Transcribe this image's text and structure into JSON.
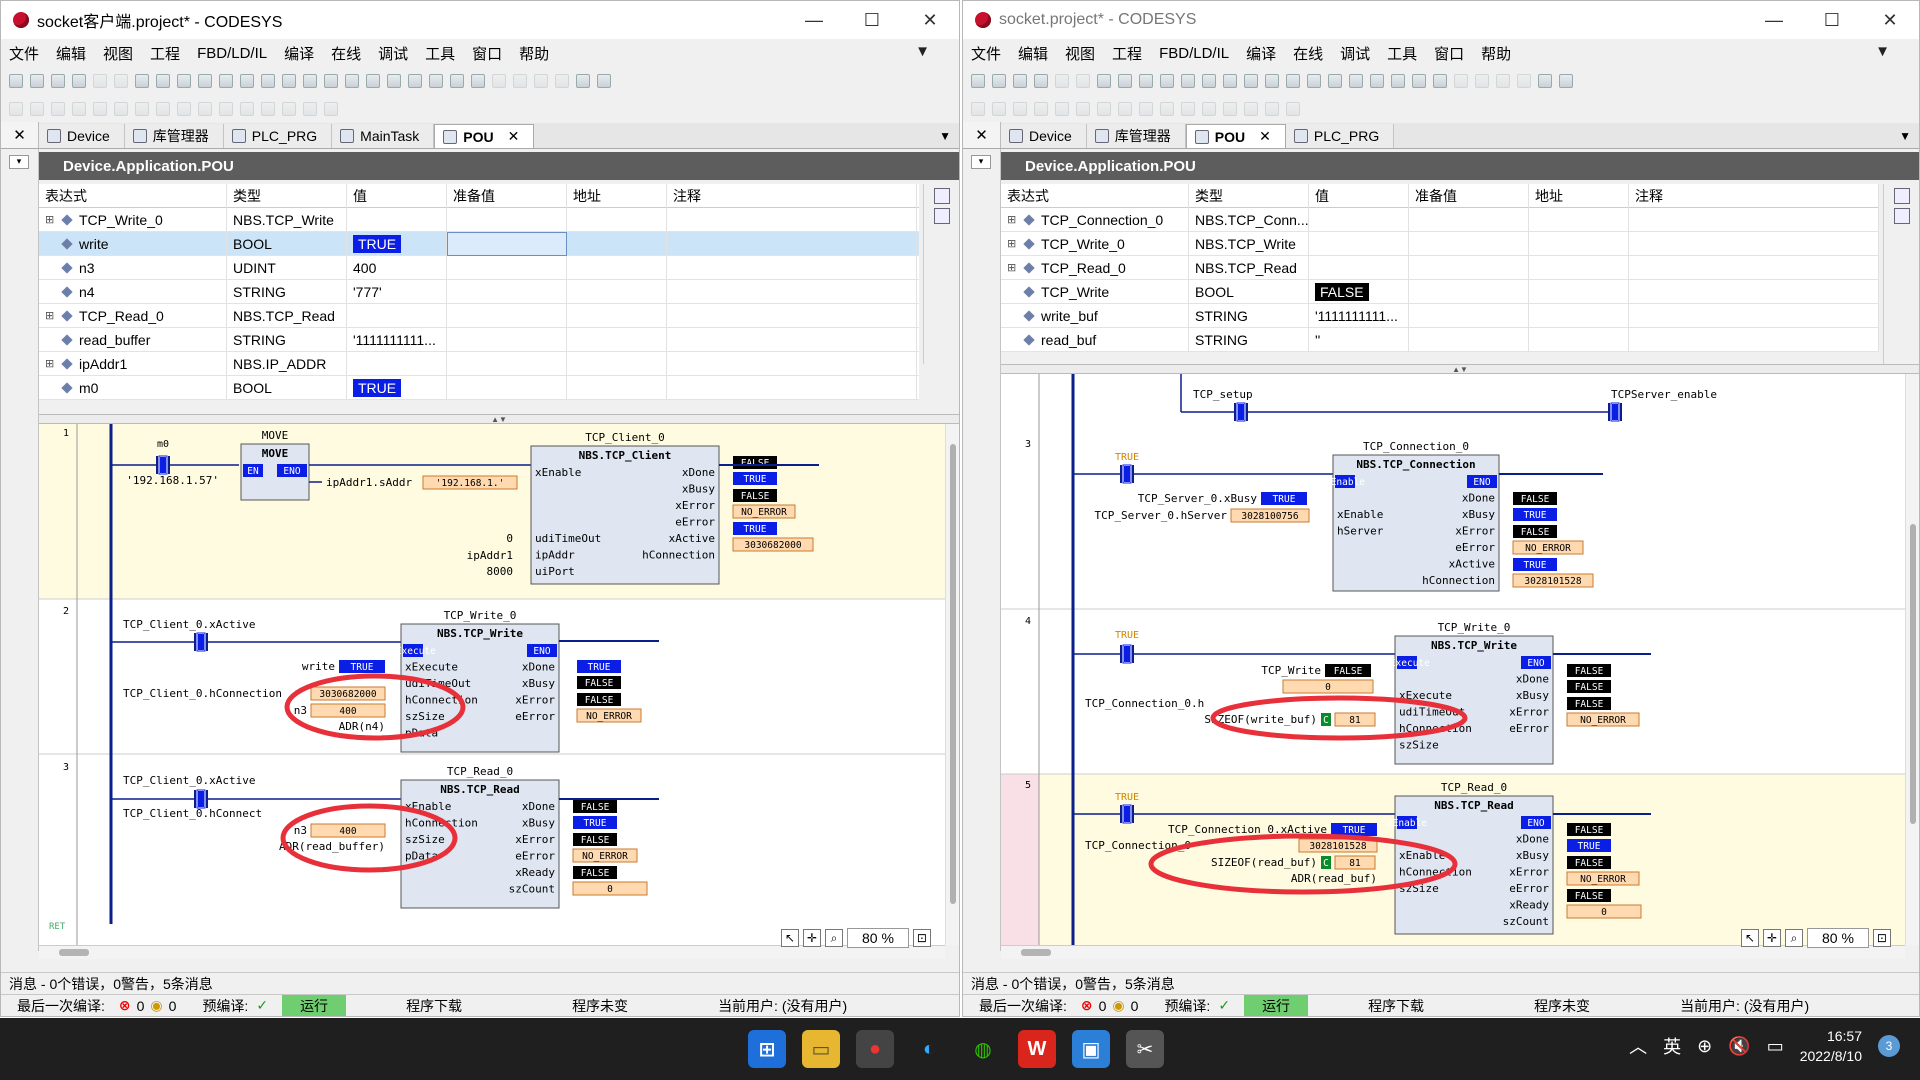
{
  "left": {
    "title": "socket客户端.project* - CODESYS",
    "menu": [
      "文件",
      "编辑",
      "视图",
      "工程",
      "FBD/LD/IL",
      "编译",
      "在线",
      "调试",
      "工具",
      "窗口",
      "帮助"
    ],
    "tabs": [
      "Device",
      "库管理器",
      "PLC_PRG",
      "MainTask",
      "POU"
    ],
    "path": "Device.Application.POU",
    "columns": [
      "表达式",
      "类型",
      "值",
      "准备值",
      "地址",
      "注释"
    ],
    "rows": [
      {
        "exp": "⊞",
        "name": "TCP_Write_0",
        "type": "NBS.TCP_Write",
        "value": ""
      },
      {
        "exp": "",
        "name": "write",
        "type": "BOOL",
        "value": "TRUE"
      },
      {
        "exp": "",
        "name": "n3",
        "type": "UDINT",
        "value": "400"
      },
      {
        "exp": "",
        "name": "n4",
        "type": "STRING",
        "value": "'777'"
      },
      {
        "exp": "⊞",
        "name": "TCP_Read_0",
        "type": "NBS.TCP_Read",
        "value": ""
      },
      {
        "exp": "",
        "name": "read_buffer",
        "type": "STRING",
        "value": "'1111111111..."
      },
      {
        "exp": "⊞",
        "name": "ipAddr1",
        "type": "NBS.IP_ADDR",
        "value": ""
      },
      {
        "exp": "",
        "name": "m0",
        "type": "BOOL",
        "value": "TRUE"
      }
    ],
    "zoom": "80 %",
    "messages": "消息 - 0个错误，0警告，5条消息",
    "status": {
      "last_compile": "最后一次编译:",
      "errors": "0",
      "warnings": "0",
      "precompile": "预编译:",
      "run": "运行",
      "download": "程序下载",
      "unchanged": "程序未变",
      "user": "当前用户: (没有用户)"
    },
    "gutter_label": "设P..",
    "ladder": {
      "r1": {
        "num": "1",
        "m0": "m0",
        "move": "MOVE",
        "en": "EN",
        "eno": "ENO",
        "ip_const": "'192.168.1.57'",
        "saddr": "ipAddr1.sAddr",
        "saddr_val": "'192.168.1.'",
        "inst": "TCP_Client_0",
        "fb": "NBS.TCP_Client",
        "xEnable": "xEnable",
        "xDone": "xDone",
        "xBusy": "xBusy",
        "xError": "xError",
        "eError": "eError",
        "xActive": "xActive",
        "hConnection": "hConnection",
        "udiTimeOut": "udiTimeOut",
        "ipAddr": "ipAddr",
        "uiPort": "uiPort",
        "zero": "0",
        "ipAddr1": "ipAddr1",
        "port": "8000",
        "v_done": "FALSE",
        "v_busy": "TRUE",
        "v_err": "FALSE",
        "v_eerr": "NO_ERROR",
        "v_act": "TRUE",
        "v_h": "3030682000"
      },
      "r2": {
        "num": "2",
        "contact": "TCP_Client_0.xActive",
        "inst": "TCP_Write_0",
        "fb": "NBS.TCP_Write",
        "write": "write",
        "write_val": "TRUE",
        "hconn": "TCP_Client_0.hConnection",
        "hval": "3030682000",
        "n3": "n3",
        "n3val": "400",
        "adr": "ADR(n4)",
        "xExecute": "xExecute",
        "udiTimeOut": "udiTimeOut",
        "hConnection": "hConnection",
        "szSize": "szSize",
        "pData": "pData",
        "xDone": "xDone",
        "xBusy": "xBusy",
        "xError": "xError",
        "eError": "eError",
        "v_done": "TRUE",
        "v_busy": "FALSE",
        "v_err": "FALSE",
        "v_eerr": "NO_ERROR"
      },
      "r3": {
        "num": "3",
        "contact": "TCP_Client_0.xActive",
        "inst": "TCP_Read_0",
        "fb": "NBS.TCP_Read",
        "hconn": "TCP_Client_0.hConnect",
        "n3": "n3",
        "n3val": "400",
        "adr": "ADR(read_buffer)",
        "xEnable": "xEnable",
        "hConnection": "hConnection",
        "szSize": "szSize",
        "pData": "pData",
        "xDone": "xDone",
        "xBusy": "xBusy",
        "xError": "xError",
        "eError": "eError",
        "xReady": "xReady",
        "szCount": "szCount",
        "v_done": "FALSE",
        "v_busy": "TRUE",
        "v_err": "FALSE",
        "v_eerr": "NO_ERROR",
        "v_ready": "FALSE",
        "v_cnt": "0"
      },
      "ret": "RET"
    }
  },
  "right": {
    "title": "socket.project* - CODESYS",
    "menu": [
      "文件",
      "编辑",
      "视图",
      "工程",
      "FBD/LD/IL",
      "编译",
      "在线",
      "调试",
      "工具",
      "窗口",
      "帮助"
    ],
    "tabs": [
      "Device",
      "库管理器",
      "POU",
      "PLC_PRG"
    ],
    "path": "Device.Application.POU",
    "columns": [
      "表达式",
      "类型",
      "值",
      "准备值",
      "地址",
      "注释"
    ],
    "rows": [
      {
        "exp": "⊞",
        "name": "TCP_Connection_0",
        "type": "NBS.TCP_Conn...",
        "value": ""
      },
      {
        "exp": "⊞",
        "name": "TCP_Write_0",
        "type": "NBS.TCP_Write",
        "value": ""
      },
      {
        "exp": "⊞",
        "name": "TCP_Read_0",
        "type": "NBS.TCP_Read",
        "value": ""
      },
      {
        "exp": "",
        "name": "TCP_Write",
        "type": "BOOL",
        "value": "FALSE"
      },
      {
        "exp": "",
        "name": "write_buf",
        "type": "STRING",
        "value": "'1111111111..."
      },
      {
        "exp": "",
        "name": "read_buf",
        "type": "STRING",
        "value": "''"
      }
    ],
    "zoom": "80 %",
    "messages": "消息 - 0个错误，0警告，5条消息",
    "status": {
      "last_compile": "最后一次编译:",
      "errors": "0",
      "warnings": "0",
      "precompile": "预编译:",
      "run": "运行",
      "download": "程序下载",
      "unchanged": "程序未变",
      "user": "当前用户: (没有用户)"
    },
    "gutter_label": "设P..",
    "ladder": {
      "top": {
        "setup": "TCP_setup",
        "enable": "TCPServer_enable"
      },
      "r3": {
        "num": "3",
        "true": "TRUE",
        "inst": "TCP_Connection_0",
        "fb": "NBS.TCP_Connection",
        "busy_in": "TCP_Server_0.xBusy",
        "busy_val": "TRUE",
        "hsrv_in": "TCP_Server_0.hServer",
        "hsrv_val": "3028100756",
        "xEnable": "xEnable",
        "hServer": "hServer",
        "xDone": "xDone",
        "xBusy": "xBusy",
        "xError": "xError",
        "eError": "eError",
        "xActive": "xActive",
        "hConnection": "hConnection",
        "v_done": "FALSE",
        "v_busy": "TRUE",
        "v_err": "FALSE",
        "v_eerr": "NO_ERROR",
        "v_act": "TRUE",
        "v_h": "3028101528"
      },
      "r4": {
        "num": "4",
        "true": "TRUE",
        "inst": "TCP_Write_0",
        "fb": "NBS.TCP_Write",
        "tw": "TCP_Write",
        "tw_val": "FALSE",
        "zero": "0",
        "hconn": "TCP_Connection_0.h",
        "sizeof": "SIZEOF(write_buf)",
        "c": "C",
        "cval": "81",
        "xExecute": "xExecute",
        "udiTimeOut": "udiTimeOut",
        "hConnection": "hConnection",
        "szSize": "szSize",
        "xDone": "xDone",
        "xBusy": "xBusy",
        "xError": "xError",
        "eError": "eError",
        "v_done": "FALSE",
        "v_busy": "FALSE",
        "v_err": "FALSE",
        "v_eerr": "NO_ERROR"
      },
      "r5": {
        "num": "5",
        "true": "TRUE",
        "inst": "TCP_Read_0",
        "fb": "NBS.TCP_Read",
        "act": "TCP_Connection_0.xActive",
        "act_val": "TRUE",
        "hconn": "TCP_Connection_0",
        "hval": "3028101528",
        "sizeof": "SIZEOF(read_buf)",
        "c": "C",
        "cval": "81",
        "adr": "ADR(read_buf)",
        "xEnable": "xEnable",
        "hConnection": "hConnection",
        "szSize": "szSize",
        "xDone": "xDone",
        "xBusy": "xBusy",
        "xError": "xError",
        "eError": "eError",
        "xReady": "xReady",
        "szCount": "szCount",
        "v_done": "FALSE",
        "v_busy": "TRUE",
        "v_err": "FALSE",
        "v_eerr": "NO_ERROR",
        "v_ready": "FALSE",
        "v_cnt": "0"
      }
    }
  },
  "taskbar": {
    "ime": "英",
    "time": "16:57",
    "date": "2022/8/10",
    "notif": "3"
  },
  "colors": {
    "true_bg": "#0a1ee6",
    "false_bg": "#000000",
    "value_box": "#ffd9b0",
    "rung_active": "#fffbe0",
    "annotation": "#e8303a"
  }
}
